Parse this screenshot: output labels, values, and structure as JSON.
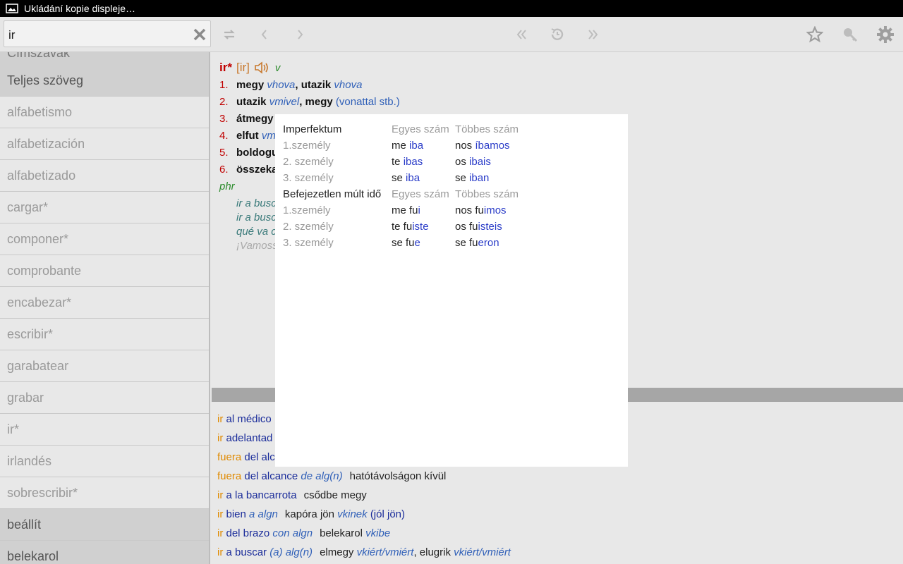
{
  "statusbar": {
    "text": "Ukládání kopie displeje…"
  },
  "search": {
    "value": "ir"
  },
  "sidebar": {
    "partial": "Címszavak",
    "fulltext": "Teljes szöveg",
    "items": [
      "alfabetismo",
      "alfabetización",
      "alfabetizado",
      "cargar*",
      "componer*",
      "comprobante",
      "encabezar*",
      "escribir*",
      "garabatear",
      "grabar",
      "ir*",
      "irlandés",
      "sobrescribir*",
      "beállít",
      "belekarol"
    ]
  },
  "entry": {
    "headword": "ir*",
    "pron": "[ir]",
    "pos": "v",
    "senses": [
      {
        "n": "1.",
        "parts": [
          {
            "c": "b",
            "t": "megy "
          },
          {
            "c": "bl",
            "t": "vhova"
          },
          {
            "c": "b",
            "t": ", utazik "
          },
          {
            "c": "bl",
            "t": "vhova"
          }
        ]
      },
      {
        "n": "2.",
        "parts": [
          {
            "c": "b",
            "t": "utazik "
          },
          {
            "c": "bl",
            "t": "vmivel"
          },
          {
            "c": "b",
            "t": ", megy "
          },
          {
            "c": "bu",
            "t": "(vonattal stb.)"
          }
        ]
      },
      {
        "n": "3.",
        "parts": [
          {
            "c": "b",
            "t": "átmegy"
          }
        ]
      },
      {
        "n": "4.",
        "parts": [
          {
            "c": "b",
            "t": "elfut "
          },
          {
            "c": "bl",
            "t": "vm"
          }
        ]
      },
      {
        "n": "5.",
        "parts": [
          {
            "c": "b",
            "t": "boldogu"
          }
        ]
      },
      {
        "n": "6.",
        "parts": [
          {
            "c": "b",
            "t": "összeka"
          }
        ]
      }
    ],
    "phr": "phr",
    "examples": [
      "ir a busc",
      "ir a busc",
      "qué va c",
      "¡Vamoss"
    ]
  },
  "bottom_rows": [
    {
      "parts": [
        {
          "c": "o",
          "t": "ir "
        },
        {
          "c": "d",
          "t": "al médico"
        }
      ]
    },
    {
      "parts": [
        {
          "c": "o",
          "t": "ir "
        },
        {
          "c": "d",
          "t": "adelantad"
        }
      ]
    },
    {
      "parts": [
        {
          "c": "o",
          "t": "fuera "
        },
        {
          "c": "d",
          "t": "del alc"
        }
      ]
    },
    {
      "parts": [
        {
          "c": "o",
          "t": "fuera "
        },
        {
          "c": "d",
          "t": "del alcance "
        },
        {
          "c": "i",
          "t": "de alg(n)"
        },
        {
          "c": "t",
          "t": "hatótávolságon kívül"
        }
      ]
    },
    {
      "parts": [
        {
          "c": "o",
          "t": "ir "
        },
        {
          "c": "d",
          "t": "a la bancarrota"
        },
        {
          "c": "t",
          "t": "csődbe megy"
        }
      ]
    },
    {
      "parts": [
        {
          "c": "o",
          "t": "ir "
        },
        {
          "c": "d",
          "t": "bien "
        },
        {
          "c": "i",
          "t": "a algn"
        },
        {
          "c": "t",
          "t": "kapóra jön "
        },
        {
          "c": "i",
          "t": "vkinek "
        },
        {
          "c": "d",
          "t": "(jól jön)"
        }
      ]
    },
    {
      "parts": [
        {
          "c": "o",
          "t": "ir "
        },
        {
          "c": "d",
          "t": "del brazo "
        },
        {
          "c": "i",
          "t": "con algn"
        },
        {
          "c": "t",
          "t": "belekarol "
        },
        {
          "c": "i",
          "t": "vkibe"
        }
      ]
    },
    {
      "parts": [
        {
          "c": "o",
          "t": "ir "
        },
        {
          "c": "d",
          "t": "a buscar "
        },
        {
          "c": "i",
          "t": "(a) alg(n)"
        },
        {
          "c": "t",
          "t": "elmegy "
        },
        {
          "c": "i",
          "t": "vkiért/vmiért"
        },
        {
          "c": "d2",
          "t": ", elugrik "
        },
        {
          "c": "i",
          "t": "vkiért/vmiért"
        }
      ]
    }
  ],
  "conjugation": {
    "rows": [
      [
        {
          "c": "hd",
          "t": "Imperfektum"
        },
        {
          "c": "gr",
          "t": "Egyes szám"
        },
        {
          "c": "gr",
          "t": "Többes szám"
        }
      ],
      [
        {
          "c": "gr",
          "t": "1.személy"
        },
        [
          {
            "c": "bk",
            "t": "me "
          },
          {
            "c": "blue",
            "t": "iba"
          }
        ],
        [
          {
            "c": "bk",
            "t": "nos "
          },
          {
            "c": "blue",
            "t": "íbamos"
          }
        ]
      ],
      [
        {
          "c": "gr",
          "t": "2. személy"
        },
        [
          {
            "c": "bk",
            "t": "te "
          },
          {
            "c": "blue",
            "t": "ibas"
          }
        ],
        [
          {
            "c": "bk",
            "t": "os "
          },
          {
            "c": "blue",
            "t": "ibais"
          }
        ]
      ],
      [
        {
          "c": "gr",
          "t": "3. személy"
        },
        [
          {
            "c": "bk",
            "t": "se "
          },
          {
            "c": "blue",
            "t": "iba"
          }
        ],
        [
          {
            "c": "bk",
            "t": "se "
          },
          {
            "c": "blue",
            "t": "iban"
          }
        ]
      ],
      [
        {
          "c": "hd",
          "t": "Befejezetlen múlt idő"
        },
        {
          "c": "gr",
          "t": "Egyes szám"
        },
        {
          "c": "gr",
          "t": "Többes szám"
        }
      ],
      [
        {
          "c": "gr",
          "t": "1.személy"
        },
        [
          {
            "c": "bk",
            "t": "me fu"
          },
          {
            "c": "blue",
            "t": "i"
          }
        ],
        [
          {
            "c": "bk",
            "t": "nos fu"
          },
          {
            "c": "blue",
            "t": "imos"
          }
        ]
      ],
      [
        {
          "c": "gr",
          "t": "2. személy"
        },
        [
          {
            "c": "bk",
            "t": "te fu"
          },
          {
            "c": "blue",
            "t": "iste"
          }
        ],
        [
          {
            "c": "bk",
            "t": "os fu"
          },
          {
            "c": "blue",
            "t": "isteis"
          }
        ]
      ],
      [
        {
          "c": "gr",
          "t": "3. személy"
        },
        [
          {
            "c": "bk",
            "t": "se fu"
          },
          {
            "c": "blue",
            "t": "e"
          }
        ],
        [
          {
            "c": "bk",
            "t": "se fu"
          },
          {
            "c": "blue",
            "t": "eron"
          }
        ]
      ]
    ]
  },
  "icons": {
    "toolbar": [
      "sync-icon",
      "prev-icon",
      "next-icon",
      "history-back-icon",
      "history-icon",
      "history-forward-icon",
      "star-icon",
      "search-key-icon",
      "settings-icon"
    ]
  },
  "colors": {
    "headword": "#c00000",
    "italic_blue": "#3060b8",
    "orange": "#e08a00",
    "dark_blue": "#1a2c9a"
  }
}
